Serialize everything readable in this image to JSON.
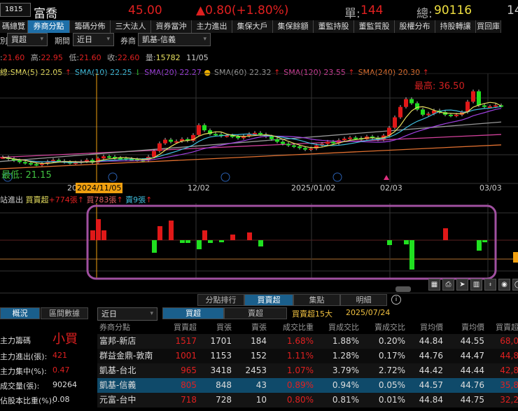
{
  "header": {
    "code": "1815",
    "name": "富喬",
    "price": "45.00",
    "change": "▲0.80(+1.80%)",
    "single_label": "單:",
    "single": "144",
    "total_label": "總:",
    "total": "90116",
    "extra": "14"
  },
  "tabs": [
    "碼總覽",
    "券商分點",
    "籌碼分佈",
    "三大法人",
    "資券當沖",
    "主力進出",
    "集保大戶",
    "集保餘額",
    "董監持股",
    "董監質股",
    "股權分布",
    "持股轉讓",
    "買回庫"
  ],
  "filters": {
    "type_label": "別",
    "type": "買超",
    "period_label": "期間",
    "period": "近日",
    "broker_label": "券商",
    "broker": "凱基-信義"
  },
  "ohlc": {
    "o_label": ":",
    "o": "21.60",
    "h_label": "高:",
    "h": "22.95",
    "l_label": "低:",
    "l": "21.60",
    "c_label": "收:",
    "c": "22.60",
    "v_label": "量:",
    "v": "15782",
    "date": "11/05"
  },
  "sma": [
    {
      "text": "線:SMA(5) 22.05",
      "arrow": "↑",
      "color": "#e8e060"
    },
    {
      "text": "SMA(10) 22.25",
      "arrow": "↓",
      "color": "#40c0e0"
    },
    {
      "text": "SMA(20) 22.27",
      "arrow": "●",
      "color": "#a040e0"
    },
    {
      "text": "SMA(60) 22.32",
      "arrow": "↑",
      "color": "#999999"
    },
    {
      "text": "SMA(120) 23.55",
      "arrow": "↑",
      "color": "#d0409a"
    },
    {
      "text": "SMA(240) 20.30",
      "arrow": "↑",
      "color": "#e07030"
    }
  ],
  "chart": {
    "high_label": "最高: 36.50",
    "low_label": "最低: 21.15",
    "price_max": 36.5,
    "price_min": 21.15,
    "x_labels": [
      "20",
      "2024/11/05",
      "12/02",
      "2025/01/02",
      "02/03",
      "03/03"
    ],
    "closes": [
      22.8,
      22.5,
      22.2,
      21.9,
      21.7,
      21.5,
      21.4,
      21.6,
      22.0,
      22.3,
      22.1,
      21.9,
      21.7,
      21.8,
      22.0,
      22.3,
      21.8,
      22.6,
      23.0,
      22.9,
      22.7,
      22.6,
      22.5,
      22.4,
      22.3,
      22.2,
      22.9,
      24.0,
      25.5,
      26.2,
      25.8,
      25.9,
      26.3,
      26.0,
      27.1,
      29.0,
      28.0,
      27.3,
      27.2,
      26.9,
      27.0,
      26.8,
      26.5,
      26.9,
      27.3,
      27.5,
      27.2,
      26.8,
      26.3,
      25.8,
      25.4,
      25.1,
      24.9,
      24.6,
      24.3,
      24.5,
      25.1,
      25.4,
      25.8,
      25.5,
      26.1,
      26.4,
      26.6,
      26.5,
      26.3,
      26.8,
      26.6,
      26.2,
      27.0,
      28.5,
      30.5,
      32.5,
      34.0,
      33.2,
      32.0,
      31.0,
      31.2,
      31.8,
      31.5,
      31.0,
      30.8,
      31.0,
      31.5,
      33.5,
      35.5,
      32.8,
      32.5,
      32.6,
      32.8,
      32.7
    ],
    "sma60": [
      22.0,
      29.6
    ],
    "sma120": [
      22.8,
      27.2
    ],
    "sma240": [
      20.6,
      25.2
    ]
  },
  "indicator": {
    "name": "站進出",
    "label1": "買賣超",
    "v1": "+774張",
    "a1": "↑",
    "label2": "買783張",
    "a2": "↑",
    "label3": "賣9張",
    "a3": "↑",
    "bars": [
      [
        16,
        14
      ],
      [
        17,
        30
      ],
      [
        18,
        14
      ],
      [
        27,
        -18
      ],
      [
        28,
        20
      ],
      [
        30,
        28
      ],
      [
        32,
        -4
      ],
      [
        33,
        -4
      ],
      [
        35,
        -13
      ],
      [
        36,
        14
      ],
      [
        37,
        -4
      ],
      [
        39,
        -3
      ],
      [
        41,
        8
      ],
      [
        44,
        11
      ],
      [
        46,
        -9
      ],
      [
        69,
        -7
      ],
      [
        72,
        -6
      ],
      [
        73,
        -42
      ],
      [
        79,
        17
      ],
      [
        85,
        -15
      ],
      [
        86,
        -3
      ]
    ]
  },
  "toolbar": [
    "▦",
    "⎙",
    "➤",
    "▥",
    "⍖",
    "◉",
    "◯"
  ],
  "subtabs": [
    "分點排行",
    "買賣超",
    "集點",
    "明細"
  ],
  "left": {
    "tabs": [
      "概況",
      "區間數據"
    ],
    "title": "主力籌碼",
    "title_val": "小買",
    "rows": [
      {
        "k": "主力進出(張):",
        "v": "421",
        "red": true
      },
      {
        "k": "主力集中(%):",
        "v": "0.47",
        "red": true
      },
      {
        "k": "成交量(張):",
        "v": "90264",
        "red": false
      },
      {
        "k": "佔股本比重(%):",
        "v": "0.08",
        "red": false
      }
    ]
  },
  "table": {
    "period": "近日",
    "buy": "買超",
    "sell": "賣超",
    "rank_title": "買賣超15大",
    "date": "2025/07/24",
    "headers": [
      "券商分點",
      "買賣超",
      "買張",
      "賣張",
      "成交比重",
      "買成交比",
      "賣成交比",
      "買均價",
      "賣均價",
      "買賣超"
    ],
    "rows": [
      [
        "富邦-新店",
        "1517",
        "1701",
        "184",
        "1.68%",
        "1.88%",
        "0.20%",
        "44.84",
        "44.55",
        "68,0"
      ],
      [
        "群益金鼎-敦南",
        "1001",
        "1153",
        "152",
        "1.11%",
        "1.28%",
        "0.17%",
        "44.76",
        "44.47",
        "44,8"
      ],
      [
        "凱基-台北",
        "965",
        "3418",
        "2453",
        "1.07%",
        "3.79%",
        "2.72%",
        "44.42",
        "44.44",
        "42,8"
      ],
      [
        "凱基-信義",
        "805",
        "848",
        "43",
        "0.89%",
        "0.94%",
        "0.05%",
        "44.57",
        "44.76",
        "35,8"
      ],
      [
        "元富-台中",
        "718",
        "728",
        "10",
        "0.80%",
        "0.81%",
        "0.01%",
        "44.84",
        "44.75",
        "32,2"
      ]
    ]
  }
}
